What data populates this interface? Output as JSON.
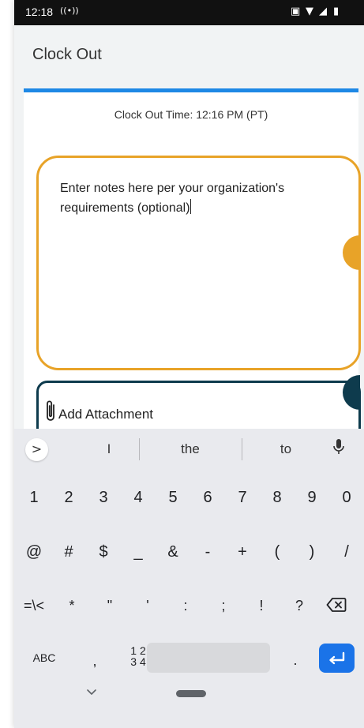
{
  "status_bar": {
    "time": "12:18"
  },
  "appbar": {
    "title": "Clock Out"
  },
  "card": {
    "clock_out_time": "Clock Out Time: 12:16 PM (PT)",
    "notes_text": "Enter notes here per your organization's requirements (optional)",
    "attachment_label": "Add Attachment"
  },
  "keyboard": {
    "suggestions": [
      "I",
      "the",
      "to"
    ],
    "row_numbers": [
      "1",
      "2",
      "3",
      "4",
      "5",
      "6",
      "7",
      "8",
      "9",
      "0"
    ],
    "row_symbols1": [
      "@",
      "#",
      "$",
      "_",
      "&",
      "-",
      "+",
      "(",
      ")",
      "/"
    ],
    "row_symbols2": [
      "=\\<",
      "*",
      "\"",
      "'",
      ":",
      ";",
      "!",
      "?"
    ],
    "abc_label": "ABC",
    "comma_label": ",",
    "nums_label_top": "1 2",
    "nums_label_bottom": "3 4",
    "period_label": "."
  },
  "colors": {
    "accent_blue": "#1e88e5",
    "notes_border": "#e8a328",
    "attach_border": "#0e3b4d",
    "enter_key": "#1a73e8"
  },
  "icons": [
    "cast-icon",
    "wifi-icon",
    "signal-icon",
    "battery-icon",
    "paperclip-icon",
    "mic-icon",
    "backspace-icon",
    "enter-icon",
    "chevron-down-icon"
  ]
}
